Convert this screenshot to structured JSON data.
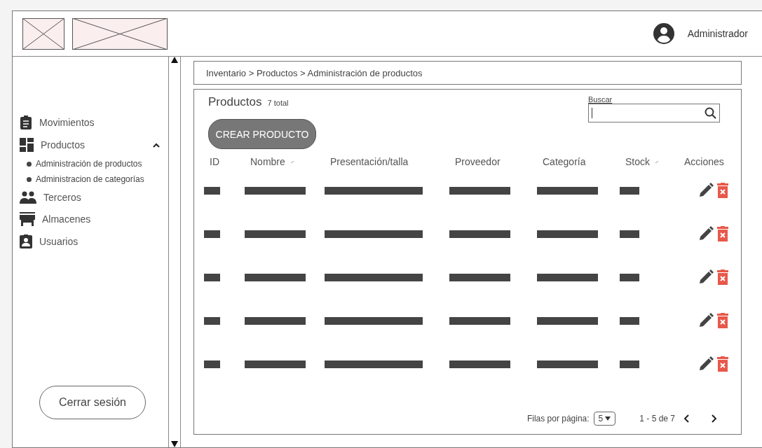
{
  "header": {
    "user": "Administrador"
  },
  "sidebar": {
    "items": [
      {
        "label": "Movimientos"
      },
      {
        "label": "Productos",
        "expanded": true,
        "children": [
          {
            "label": "Administración de productos"
          },
          {
            "label": "Administracion de categorías"
          }
        ]
      },
      {
        "label": "Terceros"
      },
      {
        "label": "Almacenes"
      },
      {
        "label": "Usuarios"
      }
    ],
    "logout": "Cerrar sesión"
  },
  "breadcrumb": "Inventario > Productos > Administración de productos",
  "card": {
    "title": "Productos",
    "count": "7 total",
    "create_button": "CREAR PRODUCTO",
    "search": {
      "label": "Buscar"
    }
  },
  "table": {
    "columns": [
      {
        "label": "ID",
        "sortable": false
      },
      {
        "label": "Nombre",
        "sortable": true
      },
      {
        "label": "Presentación/talla",
        "sortable": false
      },
      {
        "label": "Proveedor",
        "sortable": false
      },
      {
        "label": "Categoría",
        "sortable": false
      },
      {
        "label": "Stock",
        "sortable": true
      },
      {
        "label": "Acciones",
        "sortable": false
      }
    ],
    "rows": [
      {
        "kind": "placeholder"
      },
      {
        "kind": "placeholder"
      },
      {
        "kind": "placeholder"
      },
      {
        "kind": "placeholder"
      },
      {
        "kind": "placeholder"
      }
    ]
  },
  "pagination": {
    "rows_label": "Filas por página:",
    "rows_value": "5",
    "range": "1 - 5 de 7"
  }
}
